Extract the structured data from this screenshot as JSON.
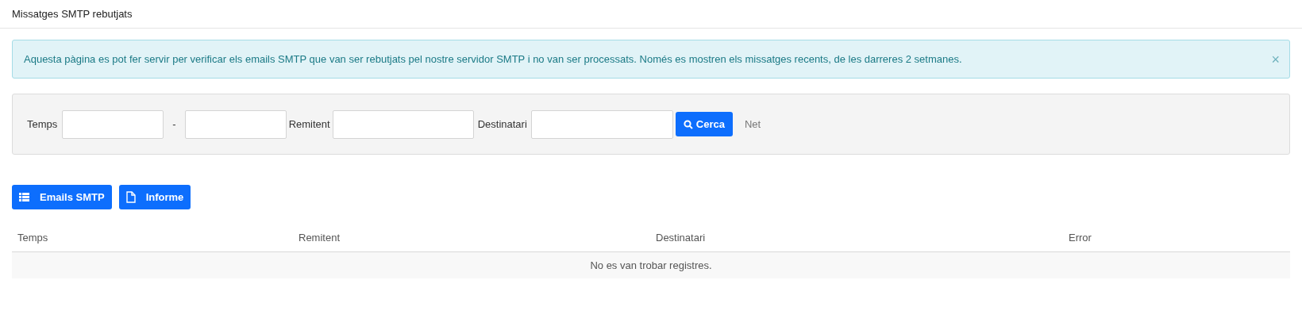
{
  "header": {
    "title": "Missatges SMTP rebutjats"
  },
  "alert": {
    "text": "Aquesta pàgina es pot fer servir per verificar els emails SMTP que van ser rebutjats pel nostre servidor SMTP i no van ser processats. Només es mostren els missatges recents, de les darreres 2 setmanes.",
    "close": "×"
  },
  "filters": {
    "time_label": "Temps",
    "separator": "-",
    "sender_label": "Remitent",
    "recipient_label": "Destinatari",
    "search_button": "Cerca",
    "clear_link": "Net"
  },
  "actions": [
    {
      "label": "Emails SMTP",
      "kind": "list"
    },
    {
      "label": "Informe",
      "kind": "file"
    }
  ],
  "table": {
    "columns": [
      "Temps",
      "Remitent",
      "Destinatari",
      "Error"
    ],
    "empty_message": "No es van trobar registres."
  }
}
